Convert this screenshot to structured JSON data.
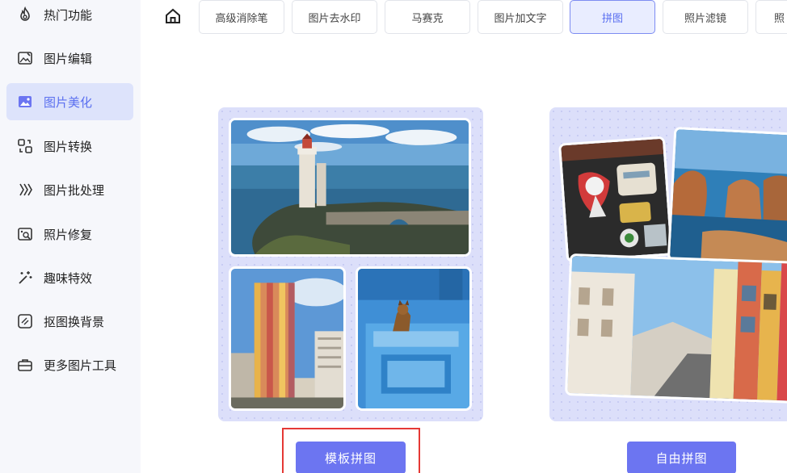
{
  "sidebar": {
    "items": [
      {
        "label": "热门功能",
        "icon": "flame-icon"
      },
      {
        "label": "图片编辑",
        "icon": "image-edit-icon"
      },
      {
        "label": "图片美化",
        "icon": "image-beautify-icon",
        "active": true
      },
      {
        "label": "图片转换",
        "icon": "convert-icon"
      },
      {
        "label": "图片批处理",
        "icon": "batch-icon"
      },
      {
        "label": "照片修复",
        "icon": "photo-repair-icon"
      },
      {
        "label": "趣味特效",
        "icon": "magic-wand-icon"
      },
      {
        "label": "抠图换背景",
        "icon": "cutout-icon"
      },
      {
        "label": "更多图片工具",
        "icon": "toolbox-icon"
      }
    ]
  },
  "tabs": {
    "home_icon": "home-icon",
    "items": [
      {
        "label": "高级消除笔"
      },
      {
        "label": "图片去水印"
      },
      {
        "label": "马赛克"
      },
      {
        "label": "图片加文字"
      },
      {
        "label": "拼图",
        "active": true
      },
      {
        "label": "照片滤镜"
      },
      {
        "label": "照"
      }
    ]
  },
  "cards": {
    "template": {
      "button_label": "模板拼图"
    },
    "free": {
      "button_label": "自由拼图"
    }
  },
  "colors": {
    "accent": "#6c75f1",
    "active_bg": "#dde3fb",
    "card_bg": "#dcdffa",
    "highlight": "#e53935"
  }
}
